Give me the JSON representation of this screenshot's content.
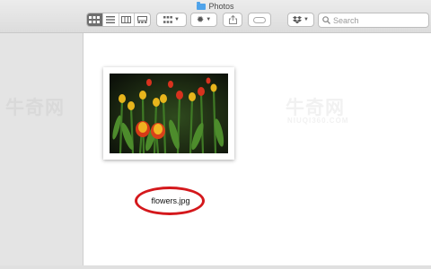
{
  "window": {
    "title": "Photos"
  },
  "toolbar": {
    "view_icons": [
      "icon-view-icon",
      "list-view-icon",
      "column-view-icon",
      "gallery-view-icon"
    ],
    "group_icon": "grid-group-icon",
    "action_icon": "gear-icon",
    "share_icon": "share-icon",
    "tag_icon": "tag-icon",
    "dropbox_icon": "dropbox-icon"
  },
  "search": {
    "placeholder": "Search"
  },
  "file": {
    "name": "flowers.jpg"
  },
  "watermark": {
    "left": "牛奇网",
    "right": "牛奇网",
    "right_sub": "NIUQI360.COM"
  },
  "colors": {
    "highlight_circle": "#d4181c",
    "folder": "#4fa3ea",
    "active_view": "#6e6e6e"
  }
}
